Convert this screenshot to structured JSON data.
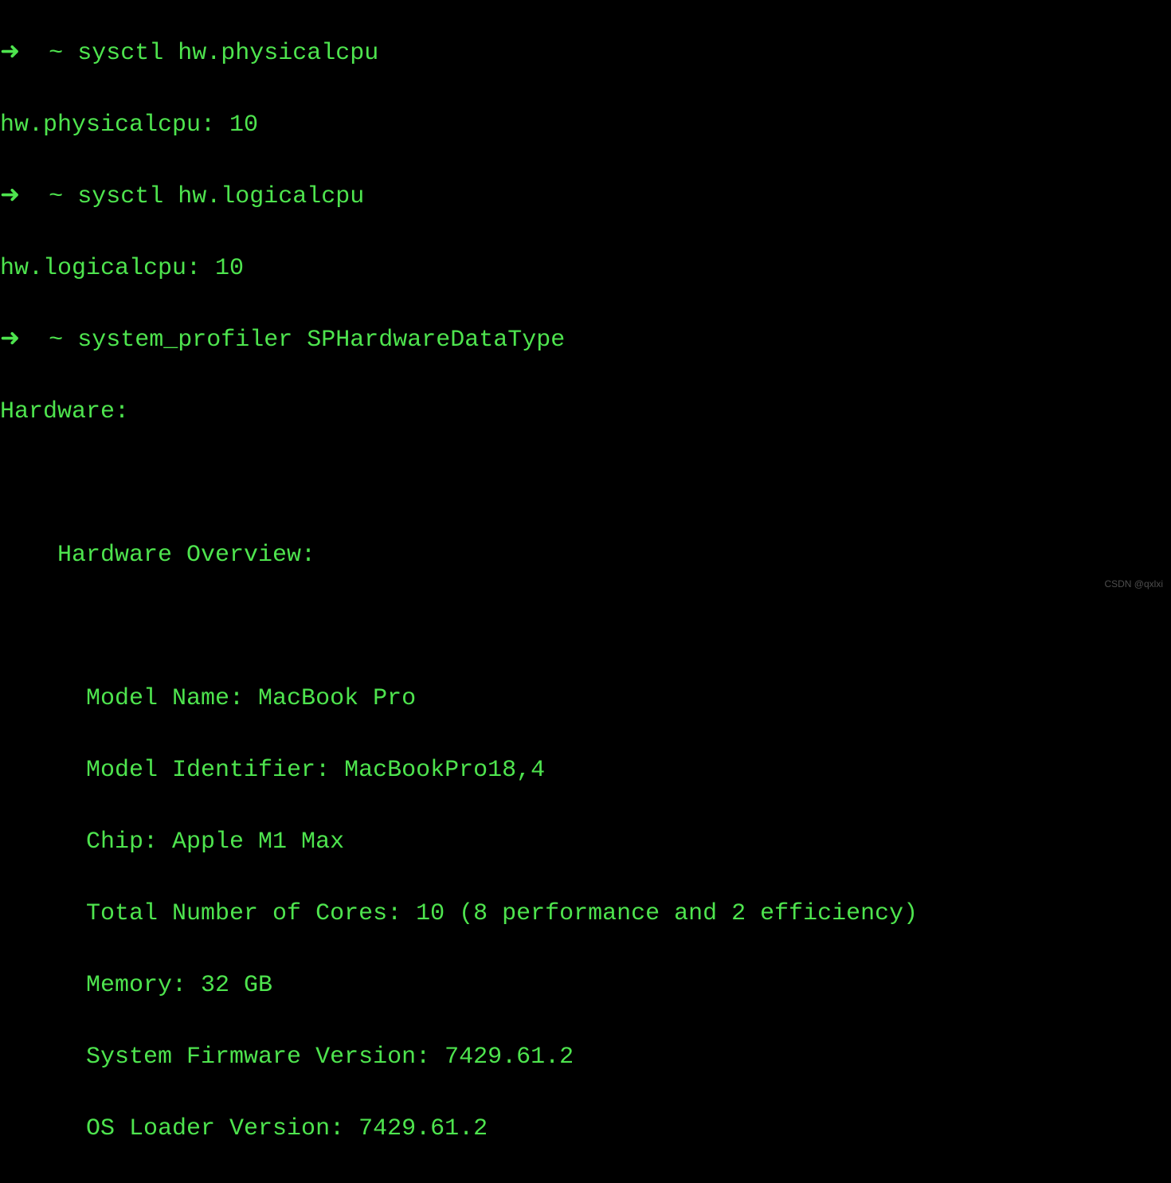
{
  "terminal": {
    "prompt_arrow": "➜",
    "prompt_tilde": "~",
    "command1": "sysctl hw.physicalcpu",
    "output1": "hw.physicalcpu: 10",
    "command2": "sysctl hw.logicalcpu",
    "output2": "hw.logicalcpu: 10",
    "command3": "system_profiler SPHardwareDataType",
    "hardware_header": "Hardware:",
    "hardware_overview": "    Hardware Overview:",
    "model_name": "      Model Name: MacBook Pro",
    "model_identifier": "      Model Identifier: MacBookPro18,4",
    "chip": "      Chip: Apple M1 Max",
    "total_cores": "      Total Number of Cores: 10 (8 performance and 2 efficiency)",
    "memory": "      Memory: 32 GB",
    "firmware": "      System Firmware Version: 7429.61.2",
    "os_loader": "      OS Loader Version: 7429.61.2"
  },
  "watermark": "CSDN @qxlxi"
}
